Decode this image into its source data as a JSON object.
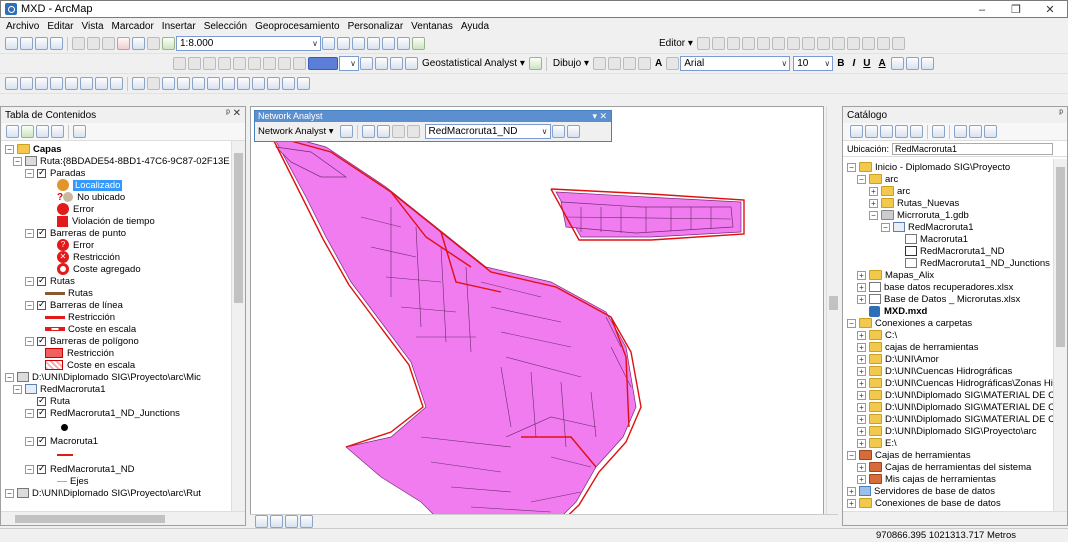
{
  "window": {
    "title": "MXD - ArcMap",
    "minimize": "–",
    "restore": "❐",
    "close": "✕"
  },
  "menu": [
    "Archivo",
    "Editar",
    "Vista",
    "Marcador",
    "Insertar",
    "Selección",
    "Geoprocesamiento",
    "Personalizar",
    "Ventanas",
    "Ayuda"
  ],
  "toolbar": {
    "scale": "1:8.000",
    "editor": "Editor ▾",
    "geostat": "Geostatistical Analyst ▾",
    "dibujo": "Dibujo ▾",
    "font": "Arial",
    "font_size": "10",
    "bold": "B",
    "italic": "I",
    "underline": "U",
    "font_color": "A"
  },
  "toc": {
    "title": "Tabla de Contenidos",
    "pin": "ᵖ ✕",
    "items": {
      "capas": "Capas",
      "ruta": "Ruta:{8BDADE54-8BD1-47C6-9C87-02F13E",
      "paradas": "Paradas",
      "localizado": "Localizado",
      "no_ubicado": "No ubicado",
      "error1": "Error",
      "violacion": "Violación de tiempo",
      "barreras_punto": "Barreras de punto",
      "error2": "Error",
      "restriccion1": "Restricción",
      "coste_agregado": "Coste agregado",
      "rutas": "Rutas",
      "rutas_sym": "Rutas",
      "barreras_linea": "Barreras de línea",
      "restriccion2": "Restricción",
      "coste_escala1": "Coste en escala",
      "barreras_poligono": "Barreras de polígono",
      "restriccion3": "Restricción",
      "coste_escala2": "Coste en escala",
      "path_mic": "D:\\UNI\\Diplomado SIG\\Proyecto\\arc\\Mic",
      "red": "RedMacroruta1",
      "ruta_layer": "Ruta",
      "junctions": "RedMacroruta1_ND_Junctions",
      "macroruta": "Macroruta1",
      "red_nd": "RedMacroruta1_ND",
      "ejes": "Ejes",
      "path_rut": "D:\\UNI\\Diplomado SIG\\Proyecto\\arc\\Rut"
    }
  },
  "network_analyst": {
    "title": "Network Analyst",
    "close": "▾ ✕",
    "menu": "Network Analyst ▾",
    "dataset": "RedMacroruta1_ND"
  },
  "catalog": {
    "title": "Catálogo",
    "pin": "ᵖ",
    "location_label": "Ubicación:",
    "location_value": "RedMacroruta1",
    "items": {
      "inicio": "Inicio - Diplomado SIG\\Proyecto",
      "arc1": "arc",
      "arc2": "arc",
      "rutas_nuevas": "Rutas_Nuevas",
      "micro_gdb": "Micrroruta_1.gdb",
      "red": "RedMacroruta1",
      "macroruta": "Macroruta1",
      "red_nd": "RedMacroruta1_ND",
      "red_nd_j": "RedMacroruta1_ND_Junctions",
      "mapas": "Mapas_Alix",
      "base1": "base datos recuperadores.xlsx",
      "base2": "Base de Datos _ Microrutas.xlsx",
      "mxd": "MXD.mxd",
      "conexiones": "Conexiones a carpetas",
      "c": "C:\\",
      "cajas": "cajas de herramientas",
      "amor": "D:\\UNI\\Amor",
      "cuencas1": "D:\\UNI\\Cuencas Hidrográficas",
      "cuencas2": "D:\\UNI\\Cuencas Hidrográficas\\Zonas Hi",
      "mat1": "D:\\UNI\\Diplomado SIG\\MATERIAL DE CL",
      "mat2": "D:\\UNI\\Diplomado SIG\\MATERIAL DE CL",
      "mat3": "D:\\UNI\\Diplomado SIG\\MATERIAL DE CL",
      "proyecto_arc": "D:\\UNI\\Diplomado SIG\\Proyecto\\arc",
      "e": "E:\\",
      "cajas_herr": "Cajas de herramientas",
      "cajas_sistema": "Cajas de herramientas del sistema",
      "mis_cajas": "Mis cajas de herramientas",
      "servidores": "Servidores de base de datos",
      "conexiones_bd": "Conexiones de base de datos"
    }
  },
  "status": {
    "coords": "970866.395  1021313.717 Metros"
  },
  "colors": {
    "polygon_fill": "#f07cf0",
    "polygon_edge": "#e01010",
    "selection": "#3399ff",
    "titlebar_na": "#5b8fd0"
  }
}
